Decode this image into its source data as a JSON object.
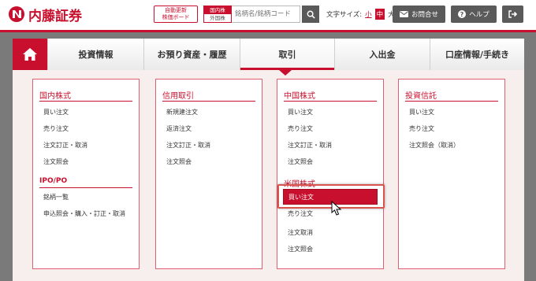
{
  "brand": {
    "name": "内藤証券",
    "color": "#c8102e"
  },
  "header": {
    "auto_update_button": [
      "自動更新",
      "株価ボード"
    ],
    "market_toggle": {
      "domestic": "国内株",
      "foreign": "外国株"
    },
    "search": {
      "placeholder": "銘柄名/銘柄コード",
      "icon": "search-icon"
    },
    "font_size": {
      "label": "文字サイズ:",
      "options": [
        "小",
        "中",
        "大"
      ],
      "selected": "中"
    },
    "contact_button": {
      "label": "お問合せ",
      "icon": "mail-icon"
    },
    "help_button": {
      "label": "ヘルプ",
      "icon": "help-icon"
    },
    "logout_button": {
      "icon": "logout-icon"
    }
  },
  "nav": {
    "home_icon": "home-icon",
    "tabs": [
      {
        "label": "投資情報"
      },
      {
        "label": "お預り資産・履歴"
      },
      {
        "label": "取引",
        "active": true
      },
      {
        "label": "入出金"
      },
      {
        "label": "口座情報/手続き"
      }
    ]
  },
  "menu": {
    "columns": [
      {
        "sections": [
          {
            "title": "国内株式",
            "items": [
              "買い注文",
              "売り注文",
              "注文訂正・取消",
              "注文照会"
            ]
          },
          {
            "title": "IPO/PO",
            "items": [
              "銘柄一覧",
              "申込照会・購入・訂正・取消"
            ]
          }
        ]
      },
      {
        "sections": [
          {
            "title": "信用取引",
            "items": [
              "新規建注文",
              "返済注文",
              "注文訂正・取消",
              "注文照会"
            ]
          }
        ]
      },
      {
        "sections": [
          {
            "title": "中国株式",
            "items": [
              "買い注文",
              "売り注文",
              "注文訂正・取消",
              "注文照会"
            ]
          },
          {
            "title": "米国株式",
            "items": [
              "買い注文",
              "売り注文",
              "注文取消",
              "注文照会"
            ],
            "highlighted_item": "買い注文"
          }
        ]
      },
      {
        "sections": [
          {
            "title": "投資信託",
            "items": [
              "買い注文",
              "売り注文",
              "注文照会（取消）"
            ]
          }
        ]
      }
    ]
  },
  "cursor_icon": "mouse-pointer-icon"
}
